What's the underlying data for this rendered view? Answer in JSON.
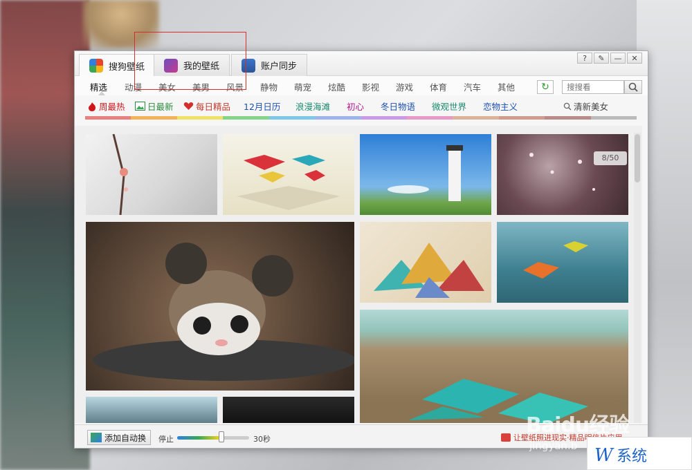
{
  "window_tabs": [
    {
      "label": "搜狗壁纸",
      "icon": "sogou-logo-icon"
    },
    {
      "label": "我的壁纸",
      "icon": "my-wallpaper-icon"
    },
    {
      "label": "账户同步",
      "icon": "account-sync-icon"
    }
  ],
  "window_controls": [
    "?",
    "✎",
    "—",
    "✕"
  ],
  "categories": [
    "精选",
    "动漫",
    "美女",
    "美男",
    "风景",
    "静物",
    "萌宠",
    "炫酷",
    "影视",
    "游戏",
    "体育",
    "汽车",
    "其他"
  ],
  "search": {
    "placeholder": "搜搜看"
  },
  "topics": [
    {
      "label": "周最热",
      "color": "#d0161b",
      "icon": "fire-icon"
    },
    {
      "label": "日最新",
      "color": "#2e8b3e",
      "icon": "image-icon"
    },
    {
      "label": "每日精品",
      "color": "#c0392b",
      "icon": "heart-icon"
    },
    {
      "label": "12月日历",
      "color": "#1b4fae"
    },
    {
      "label": "浪漫海滩",
      "color": "#1a8a6e"
    },
    {
      "label": "初心",
      "color": "#b0148f"
    },
    {
      "label": "冬日物语",
      "color": "#1b4fae"
    },
    {
      "label": "微观世界",
      "color": "#1a8a6e"
    },
    {
      "label": "恋物主义",
      "color": "#1b4fae"
    },
    {
      "label": "清新美女",
      "color": "#444444",
      "icon": "search-icon"
    }
  ],
  "color_strip": [
    "#e8807f",
    "#f3b35a",
    "#f0e168",
    "#86d38a",
    "#7fc7e6",
    "#9fb4ea",
    "#c99ae6",
    "#e79ac6",
    "#d9b49a",
    "#cf9d8f",
    "#b98b8b",
    "#bbbbbb"
  ],
  "page_counter": "8/50",
  "bottom": {
    "add_button": "添加自动换",
    "speed_stop": "停止",
    "speed_max": "30秒",
    "promo": "让壁纸照进现实·精品明信片应用"
  },
  "watermarks": {
    "baidu": "Baidu经验",
    "jingyan": "jingyan.b"
  }
}
